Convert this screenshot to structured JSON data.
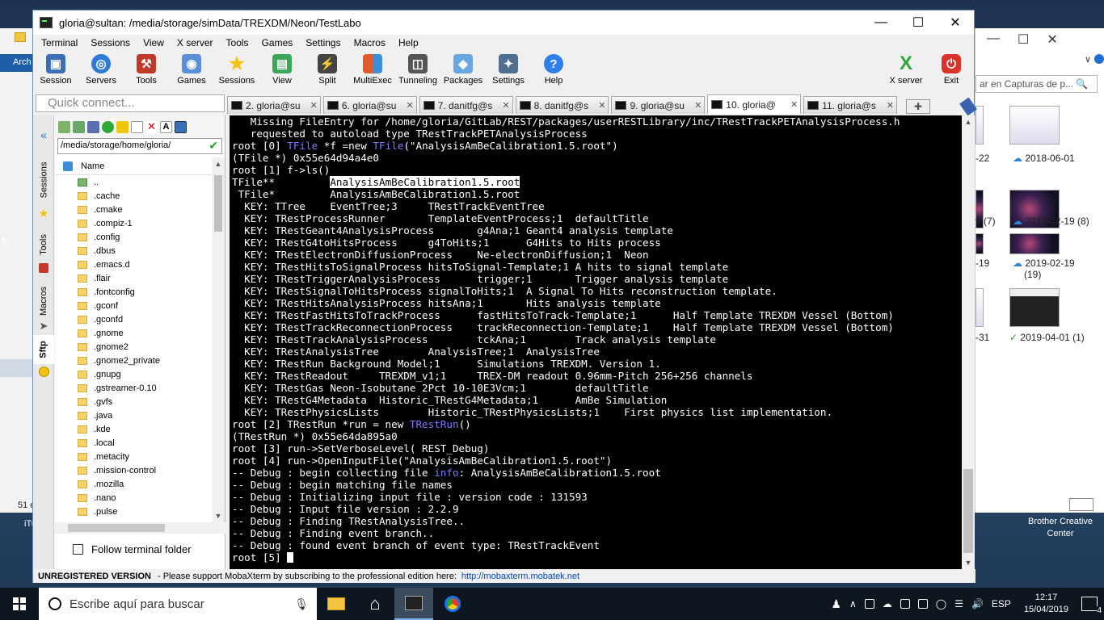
{
  "window": {
    "title": "gloria@sultan: /media/storage/simData/TREXDM/Neon/TestLabo"
  },
  "menu": [
    "Terminal",
    "Sessions",
    "View",
    "X server",
    "Tools",
    "Games",
    "Settings",
    "Macros",
    "Help"
  ],
  "toolbar": {
    "left": [
      {
        "label": "Session",
        "color": "#3a6fb8"
      },
      {
        "label": "Servers",
        "color": "#2e7bd6"
      },
      {
        "label": "Tools",
        "color": "#c0392b"
      },
      {
        "label": "Games",
        "color": "#5b8fd8"
      },
      {
        "label": "Sessions",
        "color": "#f1c40f"
      },
      {
        "label": "View",
        "color": "#3aa65a"
      },
      {
        "label": "Split",
        "color": "#444444"
      },
      {
        "label": "MultiExec",
        "color": "#e05a2b"
      },
      {
        "label": "Tunneling",
        "color": "#555555"
      },
      {
        "label": "Packages",
        "color": "#6aa7e0"
      },
      {
        "label": "Settings",
        "color": "#4f6f8f"
      },
      {
        "label": "Help",
        "color": "#2f80ed"
      }
    ],
    "xserver_label": "X server",
    "exit_label": "Exit"
  },
  "quick_connect": {
    "placeholder": "Quick connect..."
  },
  "tabs": [
    {
      "label": "2. gloria@su",
      "active": false
    },
    {
      "label": "6. gloria@su",
      "active": false
    },
    {
      "label": "7. danitfg@s",
      "active": false
    },
    {
      "label": "8. danitfg@s",
      "active": false
    },
    {
      "label": "9. gloria@su",
      "active": false
    },
    {
      "label": "10. gloria@",
      "active": true
    },
    {
      "label": "11. gloria@s",
      "active": false
    }
  ],
  "side_tabs": [
    "Sessions",
    "Tools",
    "Macros",
    "Sftp"
  ],
  "sftp": {
    "path": "/media/storage/home/gloria/",
    "column_name": "Name",
    "files": [
      "..",
      ".cache",
      ".cmake",
      ".compiz-1",
      ".config",
      ".dbus",
      ".emacs.d",
      ".flair",
      ".fontconfig",
      ".gconf",
      ".gconfd",
      ".gnome",
      ".gnome2",
      ".gnome2_private",
      ".gnupg",
      ".gstreamer-0.10",
      ".gvfs",
      ".java",
      ".kde",
      ".local",
      ".metacity",
      ".mission-control",
      ".mozilla",
      ".nano",
      ".pulse"
    ],
    "follow_label": "Follow terminal folder"
  },
  "terminal": {
    "lines": [
      "   Missing FileEntry for /home/gloria/GitLab/REST/packages/userRESTLibrary/inc/TRestTrackPETAnalysisProcess.h",
      "   requested to autoload type TRestTrackPETAnalysisProcess",
      "root [0] TFile *f =new TFile(\"AnalysisAmBeCalibration1.5.root\")",
      "(TFile *) 0x55e64d94a4e0",
      "root [1] f->ls()",
      "TFile**         AnalysisAmBeCalibration1.5.root",
      " TFile*         AnalysisAmBeCalibration1.5.root",
      "  KEY: TTree    EventTree;3     TRestTrackEventTree",
      "  KEY: TRestProcessRunner       TemplateEventProcess;1  defaultTitle",
      "  KEY: TRestGeant4AnalysisProcess       g4Ana;1 Geant4 analysis template",
      "  KEY: TRestG4toHitsProcess     g4ToHits;1      G4Hits to Hits process",
      "  KEY: TRestElectronDiffusionProcess    Ne-electronDiffusion;1  Neon",
      "  KEY: TRestHitsToSignalProcess hitsToSignal-Template;1 A hits to signal template",
      "  KEY: TRestTriggerAnalysisProcess      trigger;1       Trigger analysis template",
      "  KEY: TRestSignalToHitsProcess signalToHits;1  A Signal To Hits reconstruction template.",
      "  KEY: TRestHitsAnalysisProcess hitsAna;1       Hits analysis template",
      "  KEY: TRestFastHitsToTrackProcess      fastHitsToTrack-Template;1      Half Template TREXDM Vessel (Bottom)",
      "  KEY: TRestTrackReconnectionProcess    trackReconnection-Template;1    Half Template TREXDM Vessel (Bottom)",
      "  KEY: TRestTrackAnalysisProcess        tckAna;1        Track analysis template",
      "  KEY: TRestAnalysisTree        AnalysisTree;1  AnalysisTree",
      "  KEY: TRestRun Background Model;1      Simulations TREXDM. Version 1.",
      "  KEY: TRestReadout     TREXDM_v1;1     TREX-DM readout 0.96mm-Pitch 256+256 channels",
      "  KEY: TRestGas Neon-Isobutane 2Pct 10-10E3Vcm;1        defaultTitle",
      "  KEY: TRestG4Metadata  Historic_TRestG4Metadata;1      AmBe Simulation",
      "  KEY: TRestPhysicsLists        Historic_TRestPhysicsLists;1    First physics list implementation.",
      "root [2] TRestRun *run = new TRestRun()",
      "(TRestRun *) 0x55e64da895a0",
      "root [3] run->SetVerboseLevel( REST_Debug)",
      "root [4] run->OpenInputFile(\"AnalysisAmBeCalibration1.5.root\")",
      "-- Debug : begin collecting file info: AnalysisAmBeCalibration1.5.root",
      "-- Debug : begin matching file names",
      "-- Debug : Initializing input file : version code : 131593",
      "-- Debug : Input file version : 2.2.9",
      "-- Debug : Finding TRestAnalysisTree..",
      "-- Debug : Finding event branch..",
      "-- Debug : found event branch of event type: TRestTrackEvent",
      "root [5] "
    ]
  },
  "status": {
    "unregistered": "UNREGISTERED VERSION",
    "message": " -  Please support MobaXterm by subscribing to the professional edition here:",
    "link": "http://mobaxterm.mobatek.net"
  },
  "background_explorer": {
    "search_placeholder": "ar en Capturas de p...",
    "captions": [
      "-22",
      "2018-06-01",
      "9 (7)",
      "2019-02-19 (8)",
      "-19",
      "2019-02-19",
      "(19)",
      "-31",
      "2019-04-01 (1)"
    ]
  },
  "desktop": {
    "left_labels": [
      "Arch",
      "fo",
      "51 e",
      "iTu"
    ],
    "right_label": "Brother Creative Center"
  },
  "taskbar": {
    "search_placeholder": "Escribe aquí para buscar",
    "language": "ESP",
    "time": "12:17",
    "date": "15/04/2019",
    "notifications": "4"
  }
}
